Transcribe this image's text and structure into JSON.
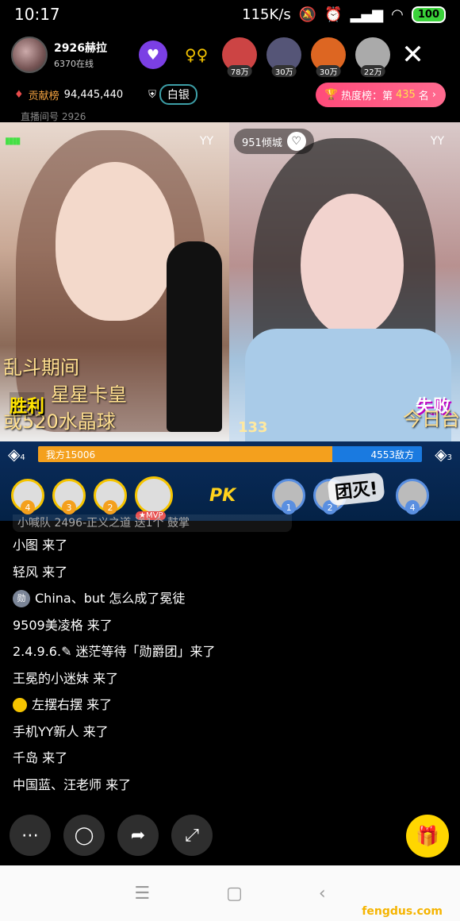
{
  "status_bar": {
    "time": "10:17",
    "speed": "115K/s",
    "battery": "100"
  },
  "host": {
    "name": "2926赫拉",
    "online": "6370在线",
    "room_id_label": "直播间号 2926"
  },
  "fans": [
    {
      "count": "78万"
    },
    {
      "count": "30万"
    },
    {
      "count": "30万"
    },
    {
      "count": "22万"
    }
  ],
  "contrib": {
    "label": "贡献榜",
    "value": "94,445,440"
  },
  "rank_badge": "白银",
  "hot": {
    "prefix": "热度榜：第",
    "rank": "435",
    "suffix": "名"
  },
  "left_video": {
    "brand": "YY",
    "brawl_line1": "乱斗期间",
    "brawl_line2": "星星卡皇",
    "brawl_line3": "或520水晶球",
    "result": "胜利"
  },
  "right_video": {
    "brand": "YY",
    "follow_name": "951倾城",
    "result": "失败",
    "text": "今日台"
  },
  "pk": {
    "timer": "133",
    "left_label": "我方15006",
    "right_label": "4553敌方",
    "left_ratio": 0.767,
    "left_rank": "4",
    "right_rank": "3",
    "pk_text": "PK",
    "wipe_text": "团灭!",
    "mvp": "MVP",
    "left_slots": [
      "4",
      "3",
      "2"
    ],
    "right_slots": [
      "1",
      "2",
      "4"
    ]
  },
  "chat": {
    "top_partial": "小喊队 2496-正义之道 送1个 鼓掌",
    "messages": [
      {
        "text": "小图 来了"
      },
      {
        "text": "轻风 来了"
      },
      {
        "text": "China、but 怎么成了冕徒",
        "medal": "勋"
      },
      {
        "text": "9509美凌格 来了"
      },
      {
        "text": "2.4.9.6.✎ 迷茫等待「勋爵团」来了"
      },
      {
        "text": "王冕的小迷妹 来了"
      },
      {
        "text": "左摆右摆 来了"
      },
      {
        "text": "手机YY新人 来了"
      },
      {
        "text": "千岛 来了"
      },
      {
        "text": "中国蓝、汪老师 来了"
      }
    ]
  },
  "watermark": "fengdus.com"
}
